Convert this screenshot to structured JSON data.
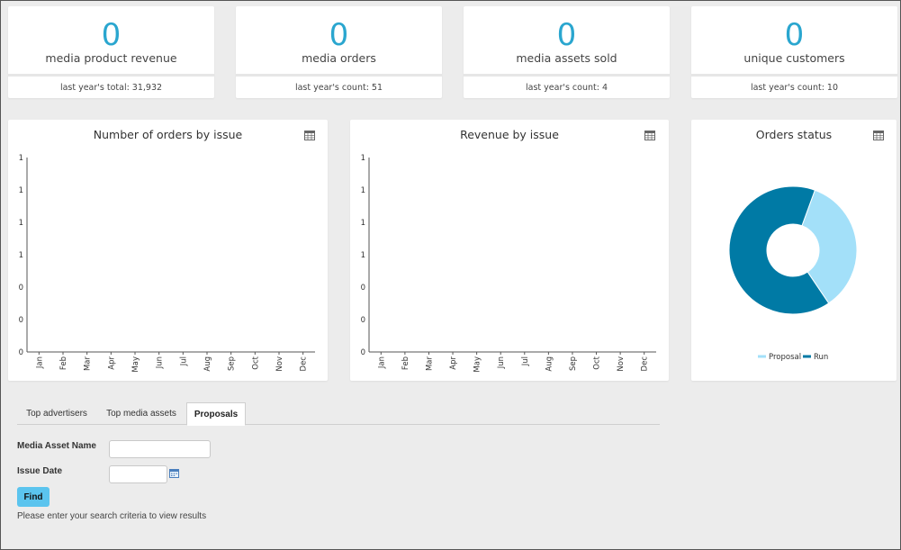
{
  "kpis": [
    {
      "value": "0",
      "label": "media product revenue",
      "sub": "last year's total: 31,932"
    },
    {
      "value": "0",
      "label": "media orders",
      "sub": "last year's count: 51"
    },
    {
      "value": "0",
      "label": "media assets sold",
      "sub": "last year's count: 4"
    },
    {
      "value": "0",
      "label": "unique customers",
      "sub": "last year's count: 10"
    }
  ],
  "charts": {
    "orders_title": "Number of orders by issue",
    "revenue_title": "Revenue by issue",
    "status_title": "Orders status",
    "legend_proposal": "Proposal",
    "legend_run": "Run"
  },
  "chart_data": [
    {
      "type": "bar",
      "title": "Number of orders by issue",
      "categories": [
        "Jan",
        "Feb",
        "Mar",
        "Apr",
        "May",
        "Jun",
        "Jul",
        "Aug",
        "Sep",
        "Oct",
        "Nov",
        "Dec"
      ],
      "values": [
        0,
        0,
        0,
        0,
        0,
        0,
        0,
        0,
        0,
        0,
        0,
        0
      ],
      "ytick_labels": [
        "1",
        "1",
        "1",
        "1",
        "0",
        "0",
        "0"
      ],
      "grid": false
    },
    {
      "type": "bar",
      "title": "Revenue by issue",
      "categories": [
        "Jan",
        "Feb",
        "Mar",
        "Apr",
        "May",
        "Jun",
        "Jul",
        "Aug",
        "Sep",
        "Oct",
        "Nov",
        "Dec"
      ],
      "values": [
        0,
        0,
        0,
        0,
        0,
        0,
        0,
        0,
        0,
        0,
        0,
        0
      ],
      "ytick_labels": [
        "1",
        "1",
        "1",
        "1",
        "0",
        "0",
        "0"
      ],
      "grid": false
    },
    {
      "type": "pie",
      "title": "Orders status",
      "categories": [
        "Proposal",
        "Run"
      ],
      "values": [
        35,
        65
      ],
      "colors": [
        "#a3e0f9",
        "#007aa5"
      ],
      "legend": "bottom"
    }
  ],
  "tabs": [
    {
      "label": "Top advertisers",
      "active": false
    },
    {
      "label": "Top media assets",
      "active": false
    },
    {
      "label": "Proposals",
      "active": true
    }
  ],
  "form": {
    "asset_name_label": "Media Asset Name",
    "asset_name_value": "",
    "issue_date_label": "Issue Date",
    "issue_date_value": "",
    "find_label": "Find",
    "hint": "Please enter your search criteria to view results"
  },
  "colors": {
    "accent": "#2aa6cf",
    "button": "#5bc4ee",
    "proposal": "#a3e0f9",
    "run": "#007aa5"
  },
  "icons": {
    "chart_menu": "calendar-table-icon",
    "date_picker": "calendar-icon"
  }
}
